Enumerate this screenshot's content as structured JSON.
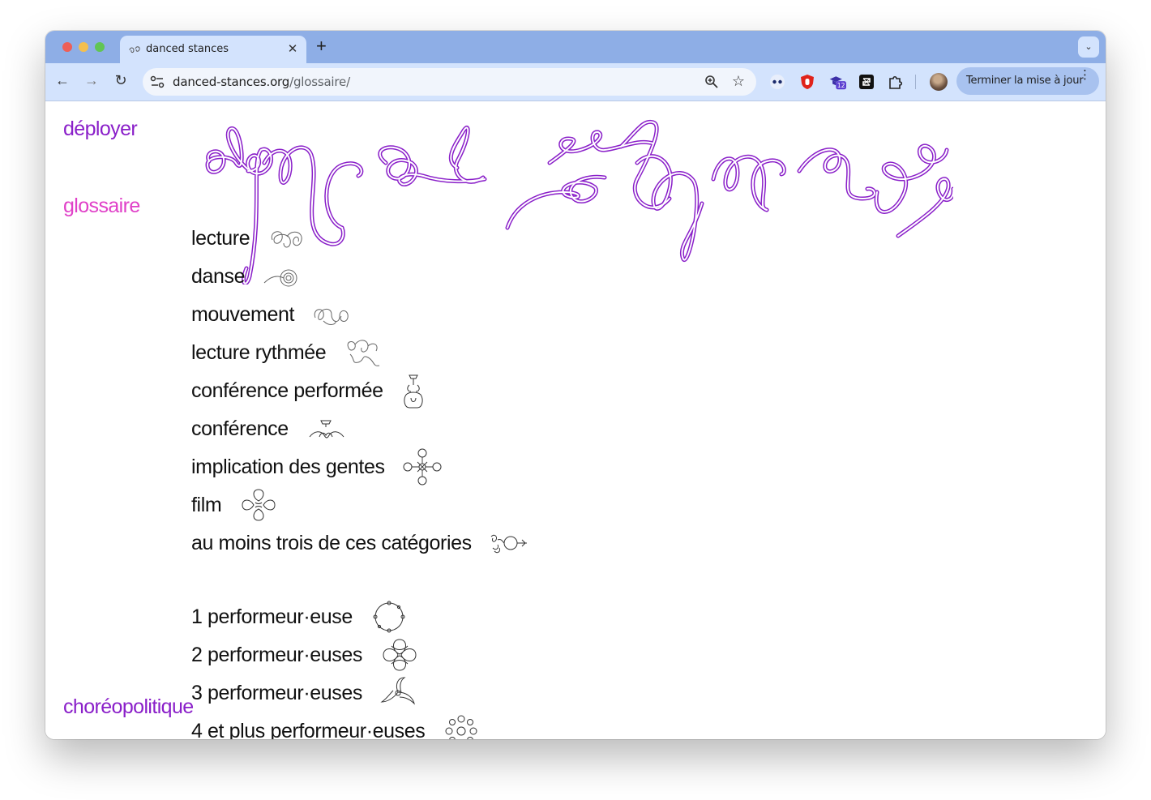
{
  "browser": {
    "tab": {
      "title": "danced stances",
      "close": "✕"
    },
    "new_tab": "+",
    "tab_search": "⌄",
    "nav": {
      "back": "←",
      "forward": "→",
      "reload": "↻"
    },
    "address": {
      "host": "danced-stances.org",
      "path": "/glossaire/"
    },
    "extensions": [
      {
        "name": "eyes-extension-icon"
      },
      {
        "name": "shield-extension-icon"
      },
      {
        "name": "graduation-cap-extension-icon",
        "badge": "12"
      },
      {
        "name": "box-extension-icon"
      },
      {
        "name": "puzzle-extensions-icon"
      }
    ],
    "update_button": "Terminer la mise à jour",
    "menu": "⋮"
  },
  "sidebar": {
    "deployer": "déployer",
    "glossaire": "glossaire",
    "choreopolitique": "choréopolitique"
  },
  "logo": {
    "text": "danced stances",
    "color": "#8a1fc9"
  },
  "glossary": {
    "groups": [
      {
        "items": [
          {
            "label": "lecture",
            "glyph": "lecture-glyph-icon"
          },
          {
            "label": "danse",
            "glyph": "danse-glyph-icon"
          },
          {
            "label": "mouvement",
            "glyph": "mouvement-glyph-icon"
          },
          {
            "label": "lecture rythmée",
            "glyph": "lecture-rythmee-glyph-icon"
          },
          {
            "label": "conférence performée",
            "glyph": "conference-performee-glyph-icon"
          },
          {
            "label": "conférence",
            "glyph": "conference-glyph-icon"
          },
          {
            "label": "implication des gentes",
            "glyph": "implication-glyph-icon"
          },
          {
            "label": "film",
            "glyph": "film-glyph-icon"
          },
          {
            "label": "au moins trois de ces catégories",
            "glyph": "trois-categories-glyph-icon"
          }
        ]
      },
      {
        "items": [
          {
            "label": "1 performeur·euse",
            "glyph": "one-performer-glyph-icon"
          },
          {
            "label": "2 performeur·euses",
            "glyph": "two-performers-glyph-icon"
          },
          {
            "label": "3 performeur·euses",
            "glyph": "three-performers-glyph-icon"
          },
          {
            "label": "4 et plus performeur·euses",
            "glyph": "four-plus-performers-glyph-icon"
          }
        ]
      }
    ]
  },
  "colors": {
    "tabstrip": "#8eaee6",
    "toolbar": "#d3e3fd",
    "link_purple": "#8a1fc9",
    "link_pink": "#e040c8"
  }
}
